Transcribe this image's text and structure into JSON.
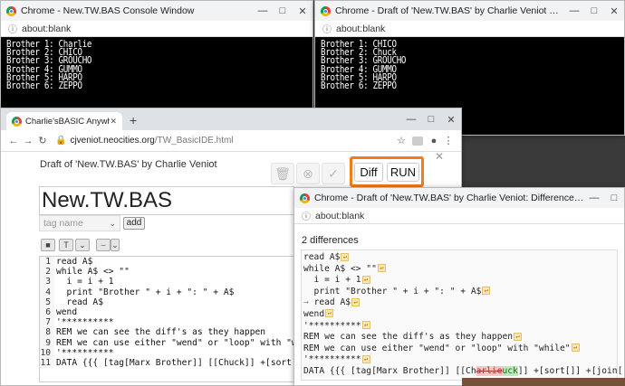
{
  "console_left": {
    "title": "Chrome - New.TW.BAS Console Window",
    "address": "about:blank",
    "lines": [
      "Brother 1: Charlie",
      "Brother 2: CHICO",
      "Brother 3: GROUCHO",
      "Brother 4: GUMMO",
      "Brother 5: HARPO",
      "Brother 6: ZEPPO"
    ]
  },
  "console_right": {
    "title": "Chrome - Draft of 'New.TW.BAS' by Charlie Veniot Console Window",
    "address": "about:blank",
    "lines": [
      "Brother 1: CHICO",
      "Brother 2: Chuck",
      "Brother 3: GROUCHO",
      "Brother 4: GUMMO",
      "Brother 5: HARPO",
      "Brother 6: ZEPPO"
    ]
  },
  "ide": {
    "tab_title": "Charlie'sBASIC Anywhere Machi",
    "url_host": "cjveniot.neocities.org",
    "url_path": "/TW_BasicIDE.html",
    "draft_title": "Draft of 'New.TW.BAS' by Charlie Veniot",
    "program_title": "New.TW.BAS",
    "tag_placeholder": "tag name",
    "add_label": "add",
    "diff_label": "Diff",
    "run_label": "RUN",
    "code_lines": [
      {
        "n": "1",
        "t": "read A$"
      },
      {
        "n": "2",
        "t": "while A$ <> \"\""
      },
      {
        "n": "3",
        "t": "  i = i + 1"
      },
      {
        "n": "4",
        "t": "  print \"Brother \" + i + \": \" + A$"
      },
      {
        "n": "5",
        "t": "  read A$"
      },
      {
        "n": "6",
        "t": "wend"
      },
      {
        "n": "7",
        "t": "'**********"
      },
      {
        "n": "8",
        "t": "REM we can see the diff's as they happen"
      },
      {
        "n": "9",
        "t": "REM we can use either \"wend\" or \"loop\" with \"while\""
      },
      {
        "n": "10",
        "t": "'**********"
      },
      {
        "n": "11",
        "t": "DATA {{{ [tag[Marx Brother]] [[Chuck]] +[sort[]] +[j"
      }
    ]
  },
  "diff": {
    "title": "Chrome - Draft of 'New.TW.BAS' by Charlie Veniot: Differences with original (New.TW.BAS)",
    "address": "about:blank",
    "count_label": "2 differences",
    "lines": [
      "read A$",
      "while A$ <> \"\"",
      "  i = i + 1",
      "  print \"Brother \" + i + \": \" + A$",
      "  read A$",
      "wend",
      "'**********",
      "REM we can see the diff's as they happen",
      "REM we can use either \"wend\" or \"loop\" with \"while\"",
      "'**********"
    ],
    "last_line_prefix": "DATA {{{ [tag[Marx Brother]] [[Ch",
    "last_line_deleted": "arlie",
    "last_line_inserted": "uck",
    "last_line_suffix": "]] +[sort[]] +[join[,]] }}}"
  }
}
